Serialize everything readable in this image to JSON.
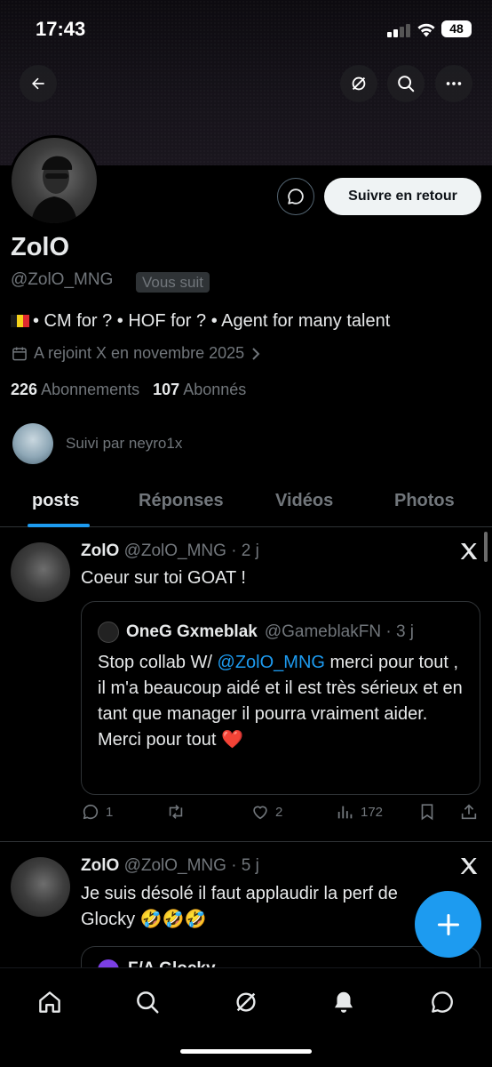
{
  "status_bar": {
    "time": "17:43",
    "battery": "48"
  },
  "profile": {
    "name": "ZolO",
    "handle": "@ZolO_MNG",
    "follows_you_badge": "Vous suit",
    "follow_back_label": "Suivre en retour",
    "bio": "• CM for ? • HOF for ? • Agent for many talent",
    "joined": "A rejoint X en novembre 2025",
    "following_count": "226",
    "following_label": "Abonnements",
    "followers_count": "107",
    "followers_label": "Abonnés",
    "followed_by": "Suivi par neyro1x"
  },
  "tabs": [
    {
      "label": "posts",
      "active": true
    },
    {
      "label": "Réponses",
      "active": false
    },
    {
      "label": "Vidéos",
      "active": false
    },
    {
      "label": "Photos",
      "active": false
    }
  ],
  "tweets": [
    {
      "name": "ZolO",
      "meta": "@ZolO_MNG · 2 j",
      "text": "Coeur sur toi GOAT !",
      "quote": {
        "name": "OneG Gxmeblak",
        "meta": "@GameblakFN · 3 j",
        "text_before": "Stop collab W/ ",
        "mention": "@ZolO_MNG",
        "text_after": " merci pour tout , il m'a beaucoup aidé et il est très sérieux et en tant que manager il pourra vraiment aider.",
        "text_line2": "Merci pour tout ❤️"
      },
      "replies": "1",
      "likes": "2",
      "views": "172"
    },
    {
      "name": "ZolO",
      "meta": "@ZolO_MNG · 5 j",
      "text": "Je suis désolé il faut applaudir la perf de Glocky 🤣🤣🤣",
      "quote_name_partial": "F/A Glocky"
    }
  ],
  "colors": {
    "accent": "#1d9bf0",
    "background": "#000000",
    "muted": "#71767b",
    "text": "#e7e9ea"
  },
  "icons": [
    "back-arrow-icon",
    "grok-icon",
    "search-icon",
    "more-icon",
    "message-icon",
    "calendar-icon",
    "chevron-right-icon",
    "x-logo-icon",
    "reply-icon",
    "retweet-icon",
    "like-icon",
    "views-icon",
    "bookmark-icon",
    "share-icon",
    "plus-icon",
    "home-icon",
    "bell-icon",
    "chat-icon"
  ]
}
